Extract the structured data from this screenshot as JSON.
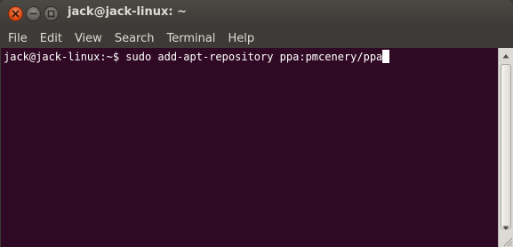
{
  "window": {
    "title": "jack@jack-linux: ~"
  },
  "menu": {
    "items": [
      "File",
      "Edit",
      "View",
      "Search",
      "Terminal",
      "Help"
    ]
  },
  "terminal": {
    "prompt": "jack@jack-linux:~$ ",
    "command": "sudo add-apt-repository ppa:pmcenery/ppa"
  },
  "icons": {
    "close": "close-icon",
    "minimize": "minimize-icon",
    "maximize": "maximize-icon",
    "scroll_up": "chevron-up-icon",
    "scroll_down": "chevron-down-icon"
  },
  "colors": {
    "titlebar": "#3c3b37",
    "terminal_background": "#300a24",
    "terminal_text": "#ffffff",
    "close_button": "#df4b16"
  }
}
